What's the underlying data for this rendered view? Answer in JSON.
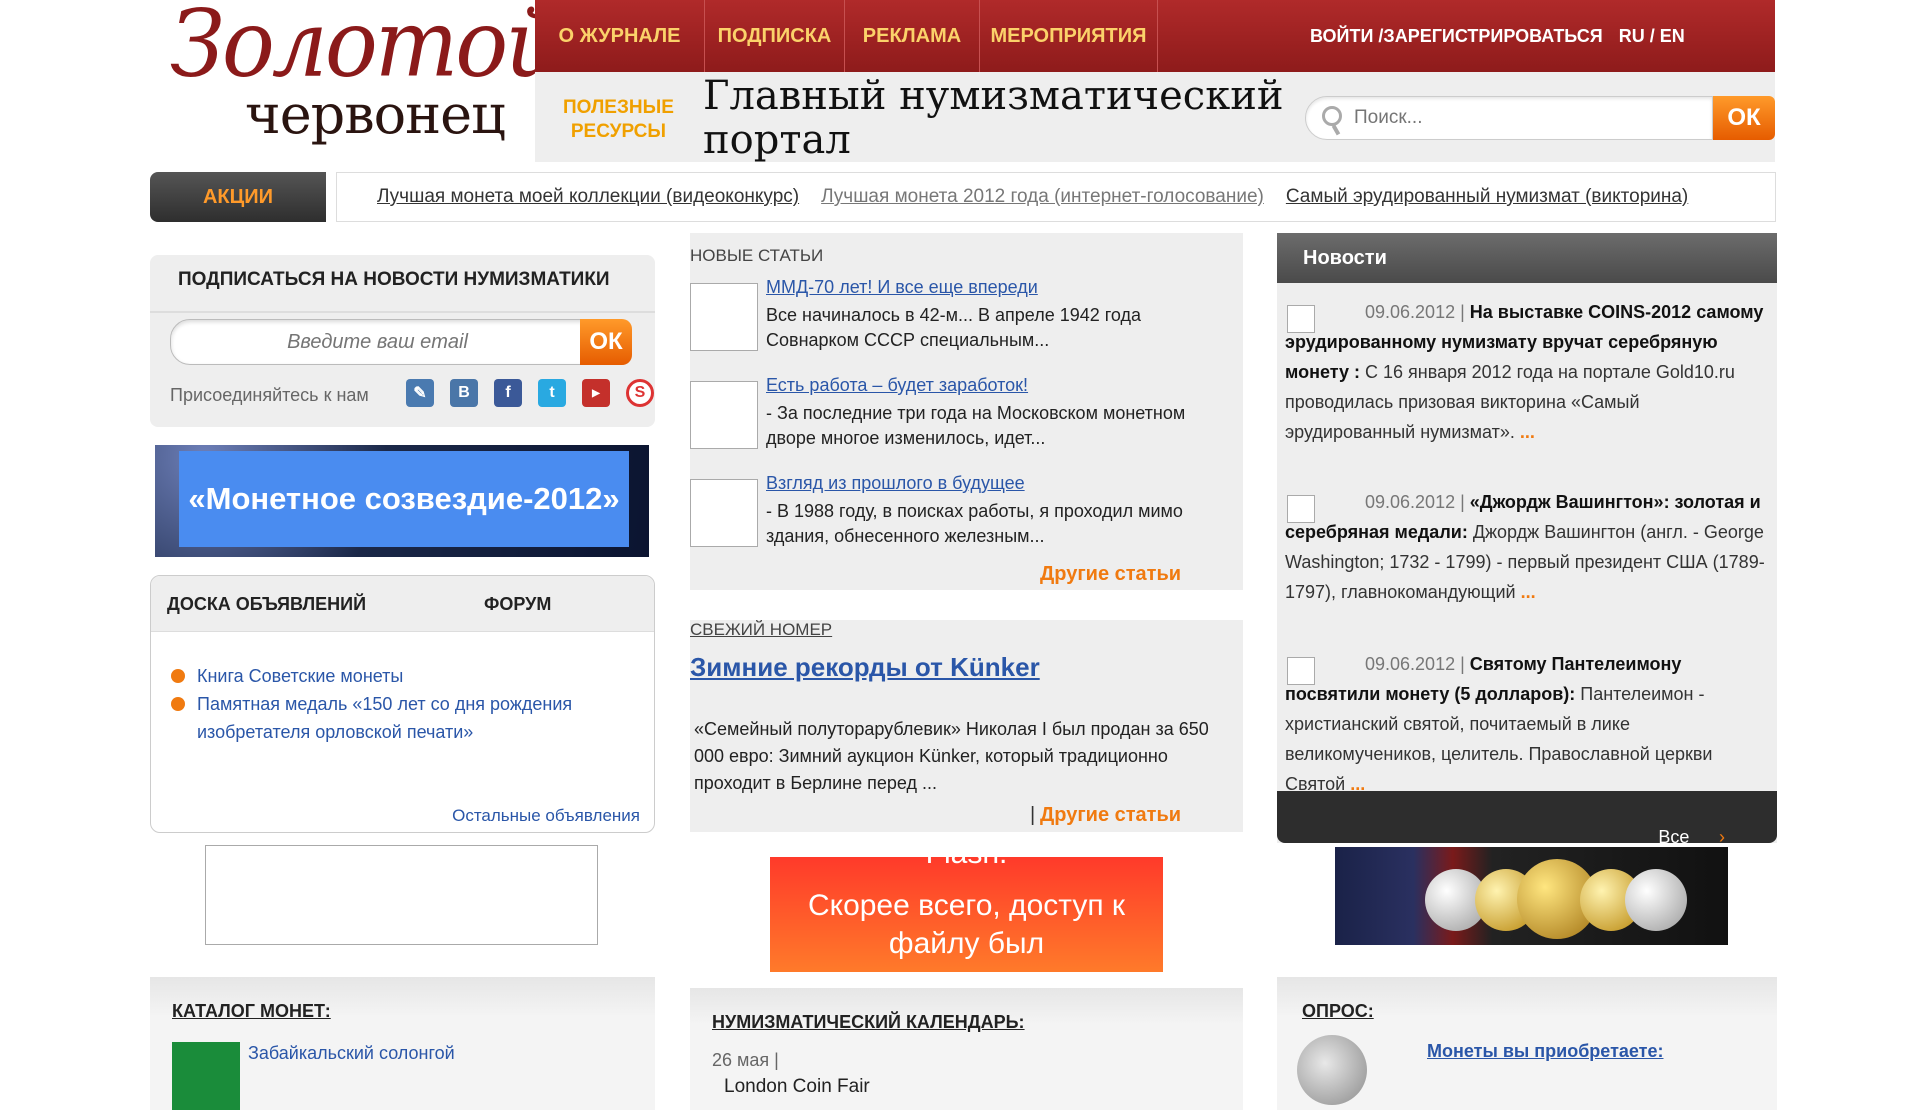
{
  "header": {
    "logo_line1": "Золотой",
    "logo_line2": "червонец",
    "nav": [
      "О ЖУРНАЛЕ",
      "ПОДПИСКА",
      "РЕКЛАМА",
      "МЕРОПРИЯТИЯ"
    ],
    "auth": "ВОЙТИ /ЗАРЕГИСТРИРОВАТЬСЯ",
    "lang": "RU / EN",
    "useful_line1": "ПОЛЕЗНЫЕ",
    "useful_line2": "РЕСУРСЫ",
    "portal_line1": "Главный нумизматический",
    "portal_line2": "портал",
    "search_placeholder": "Поиск...",
    "search_button": "ОК"
  },
  "promo": {
    "label": "АКЦИИ",
    "links": [
      "Лучшая монета моей коллекции (видеоконкурс)",
      "Лучшая монета 2012 года (интернет-голосование)",
      "Самый эрудированный нумизмат (викторина)"
    ]
  },
  "subscribe": {
    "title": "ПОДПИСАТЬСЯ НА НОВОСТИ НУМИЗМАТИКИ",
    "email_placeholder": "Введите ваш email",
    "button": "ОК",
    "join": "Присоединяйтесь к нам"
  },
  "banner1": "«Монетное созвездие-2012»",
  "board": {
    "tab1": "ДОСКА ОБЪЯВЛЕНИЙ",
    "tab2": "ФОРУМ",
    "items": [
      "Книга Советские монеты",
      "Памятная медаль «150 лет со дня рождения",
      "изобретателя орловской печати»"
    ],
    "more": "Остальные объявления"
  },
  "catalog": {
    "title": "КАТАЛОГ МОНЕТ:",
    "item": "Забайкальский солонгой"
  },
  "articles": {
    "label": "НОВЫЕ СТАТЬИ",
    "items": [
      {
        "title": "ММД-70 лет! И все еще впереди",
        "text": "Все начиналось в 42-м... В апреле 1942 года Совнарком СССР специальным..."
      },
      {
        "title": "Есть работа – будет заработок!",
        "text": "- За последние три года на Московском монетном дворе многое изменилось, идет..."
      },
      {
        "title": "Взгляд из прошлого в будущее",
        "text": "- В 1988 году, в поисках работы, я проходил мимо здания, обнесенного железным..."
      }
    ],
    "more": "Другие статьи"
  },
  "fresh": {
    "label": "СВЕЖИЙ НОМЕР",
    "title": "Зимние рекорды от Künker",
    "text": "«Семейный полуторарублевик» Николая I был продан за 650 000 евро: Зимний аукцион Künker, который традиционно проходит в Берлине перед ...",
    "more": "Другие статьи"
  },
  "orange_banner": {
    "line0": "Flash.",
    "line1": "Скорее всего, доступ к",
    "line2": "файлу был"
  },
  "calendar": {
    "title": "НУМИЗМАТИЧЕСКИЙ КАЛЕНДАРЬ:",
    "date": "26 мая |",
    "event": "London Coin Fair"
  },
  "news": {
    "title": "Новости",
    "items": [
      {
        "date": "09.06.2012 |",
        "headline": "На выставке COINS-2012 самому эрудированному нумизмату вручат серебряную монету :",
        "text": " С 16 января 2012 года на портале Gold10.ru проводилась призовая викторина «Самый эрудированный нумизмат».",
        "dots": "..."
      },
      {
        "date": "09.06.2012 |",
        "headline": "«Джордж Вашингтон»: золотая и серебряная медали:",
        "text": " Джордж Вашингтон (англ. - George Washington; 1732 - 1799) - первый президент США (1789-1797), главнокомандующий",
        "dots": "..."
      },
      {
        "date": "09.06.2012 |",
        "headline": "Святому Пантелеимону посвятили монету (5 долларов):",
        "text": " Пантелеимон - христианский святой, почитаемый в лике великомучеников, целитель. Православной церкви Святой",
        "dots": "..."
      }
    ],
    "all": "Все новости"
  },
  "poll": {
    "title": "ОПРОС:",
    "question": "Монеты вы приобретаете:"
  },
  "colors": {
    "brand_red": "#9e2222",
    "accent_orange": "#f07a10",
    "link_blue": "#2a56a8"
  }
}
